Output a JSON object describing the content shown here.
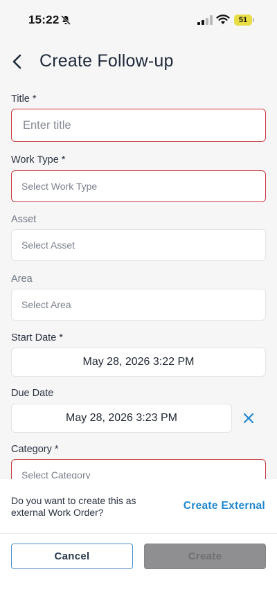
{
  "status_bar": {
    "time": "15:22",
    "battery": "51"
  },
  "header": {
    "title": "Create Follow-up"
  },
  "form": {
    "title": {
      "label": "Title *",
      "placeholder": "Enter title"
    },
    "work_type": {
      "label": "Work Type *",
      "placeholder": "Select Work Type"
    },
    "asset": {
      "label": "Asset",
      "placeholder": "Select Asset"
    },
    "area": {
      "label": "Area",
      "placeholder": "Select Area"
    },
    "start_date": {
      "label": "Start Date *",
      "value": "May 28, 2026 3:22 PM"
    },
    "due_date": {
      "label": "Due Date",
      "value": "May 28, 2026 3:23 PM"
    },
    "category": {
      "label": "Category *",
      "placeholder": "Select Category"
    }
  },
  "external": {
    "question_line1": "Do you want to create this as",
    "question_line2": "external Work Order?",
    "link_label": "Create External"
  },
  "footer": {
    "cancel_label": "Cancel",
    "create_label": "Create"
  },
  "colors": {
    "accent": "#1f87d0",
    "error_border": "#c9373f",
    "disabled_button": "#8f8f91"
  },
  "icons": [
    "bell-off-icon",
    "signal-icon",
    "wifi-icon",
    "battery-icon",
    "back-chevron-icon",
    "close-icon"
  ]
}
